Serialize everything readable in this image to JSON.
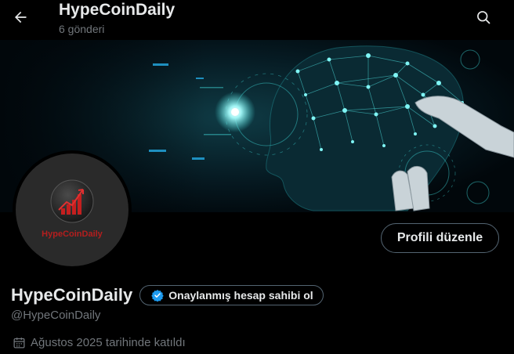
{
  "header": {
    "title": "HypeCoinDaily",
    "post_count": "6 gönderi",
    "back_icon": "arrow-left-icon",
    "search_icon": "search-icon"
  },
  "banner": {
    "description_icon": "ai-brain-network-image"
  },
  "avatar": {
    "logo_text": "HypeCoinDaily"
  },
  "profile": {
    "edit_button": "Profili düzenle",
    "display_name": "HypeCoinDaily",
    "verify_label": "Onaylanmış hesap sahibi ol",
    "handle": "@HypeCoinDaily",
    "joined": "Ağustos 2025 tarihinde katıldı"
  },
  "colors": {
    "background": "#000000",
    "text_primary": "#e7e9ea",
    "text_secondary": "#71767b",
    "border": "#536471",
    "verified_blue": "#1d9bf0",
    "logo_red": "#b41e1e",
    "banner_teal": "#3fd6d6"
  }
}
